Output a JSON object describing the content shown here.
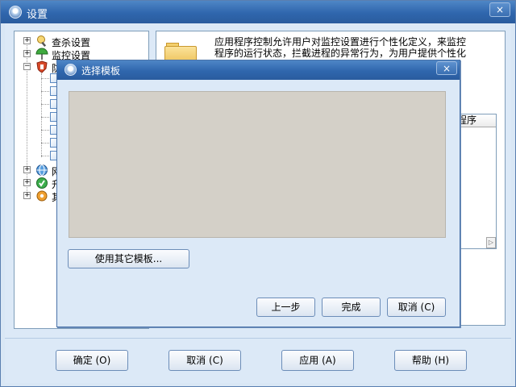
{
  "window": {
    "title": "设置",
    "close_glyph": "×"
  },
  "tree": {
    "nodes": [
      {
        "label": "查杀设置",
        "icon": "scan-icon",
        "expander": "+"
      },
      {
        "label": "监控设置",
        "icon": "umbrella-icon",
        "expander": "+"
      },
      {
        "label": "防",
        "icon": "shield-hand-icon",
        "expander": "−"
      },
      {
        "label": "网",
        "icon": "network-icon",
        "expander": "+"
      },
      {
        "label": "升",
        "icon": "upgrade-icon",
        "expander": "+"
      },
      {
        "label": "其",
        "icon": "gear-icon",
        "expander": "+"
      }
    ],
    "leaf_count": 7
  },
  "right_panel": {
    "description": "应用程序控制允许用户对监控设置进行个性化定义，来监控程序的运行状态，拦截进程的异常行为，为用户提供个性化",
    "list_header_fragment": "动程序"
  },
  "dialog": {
    "title": "选择模板",
    "close_glyph": "×",
    "use_other_template": "使用其它模板...",
    "prev": "上一步",
    "finish": "完成",
    "cancel": "取消 (C)"
  },
  "bottom_buttons": {
    "ok": "确定 (O)",
    "cancel": "取消 (C)",
    "apply": "应用 (A)",
    "help": "帮助 (H)"
  },
  "colors": {
    "titlebar": "#2f66ad",
    "client": "#dce9f7",
    "preview": "#d4d0c8"
  }
}
